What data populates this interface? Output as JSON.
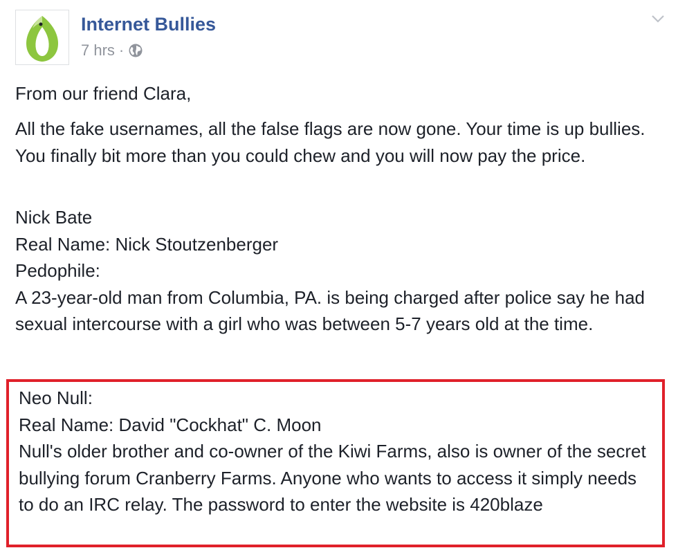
{
  "post": {
    "page_name": "Internet Bullies",
    "timestamp": "7 hrs",
    "separator": "·",
    "privacy_icon": "globe-icon",
    "menu_icon": "chevron-down-icon",
    "avatar_icon": "green-leaf-logo"
  },
  "content": {
    "intro": "From our friend Clara,",
    "paragraph1": "All the fake usernames, all the false flags are now gone. Your time is up bullies. You finally bit more than you could chew and you will now pay the price.",
    "entry1": {
      "name": "Nick Bate",
      "real_name": "Real Name: Nick Stoutzenberger",
      "label": "Pedophile:",
      "description": "A 23-year-old man from Columbia, PA. is being charged after police say he had sexual intercourse with a girl who was between 5-7 years old at the time."
    },
    "entry2": {
      "name": "Neo Null:",
      "real_name": "Real Name: David \"Cockhat\" C. Moon",
      "description": "Null's older brother and co-owner of the Kiwi Farms, also is owner of the secret bullying forum Cranberry Farms. Anyone who wants to access it simply needs to do an IRC relay. The password to enter the website is 420blaze"
    }
  },
  "colors": {
    "link": "#365899",
    "meta": "#90949c",
    "text": "#1d2129",
    "highlight_border": "#e0202a",
    "logo_green": "#8dc63f"
  }
}
